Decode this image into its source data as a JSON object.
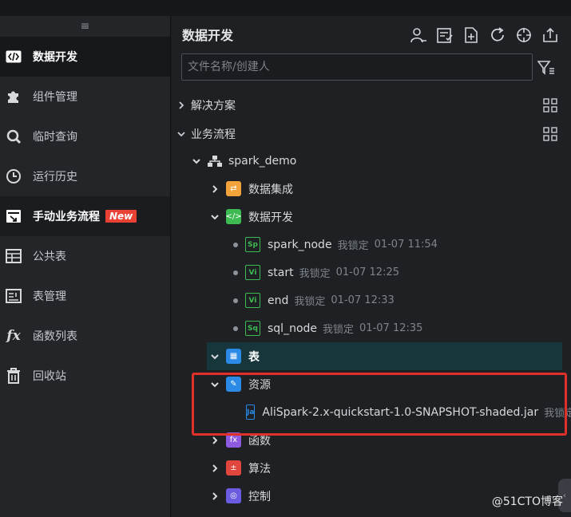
{
  "sidebar": {
    "items": [
      {
        "label": "数据开发",
        "icon": "code-icon"
      },
      {
        "label": "组件管理",
        "icon": "puzzle-icon"
      },
      {
        "label": "临时查询",
        "icon": "search-icon"
      },
      {
        "label": "运行历史",
        "icon": "clock-icon"
      },
      {
        "label": "手动业务流程",
        "icon": "manual-flow-icon",
        "badge": "New"
      },
      {
        "label": "公共表",
        "icon": "table-icon"
      },
      {
        "label": "表管理",
        "icon": "table-manage-icon"
      },
      {
        "label": "函数列表",
        "icon": "function-icon"
      },
      {
        "label": "回收站",
        "icon": "trash-icon"
      }
    ]
  },
  "panel": {
    "title": "数据开发",
    "search_placeholder": "文件名称/创建人"
  },
  "tree": {
    "solutions": "解决方案",
    "business_flow": "业务流程",
    "project": "spark_demo",
    "data_integration": "数据集成",
    "data_dev": "数据开发",
    "nodes": [
      {
        "tag": "Sp",
        "name": "spark_node",
        "lock": "我锁定",
        "time": "01-07 11:54"
      },
      {
        "tag": "Vi",
        "name": "start",
        "lock": "我锁定",
        "time": "01-07 12:25"
      },
      {
        "tag": "Vi",
        "name": "end",
        "lock": "我锁定",
        "time": "01-07 12:33"
      },
      {
        "tag": "Sq",
        "name": "sql_node",
        "lock": "我锁定",
        "time": "01-07 12:35"
      }
    ],
    "table": "表",
    "resource": "资源",
    "resource_file": {
      "tag": "Ja",
      "name": "AliSpark-2.x-quickstart-1.0-SNAPSHOT-shaded.jar",
      "lock": "我锁定"
    },
    "function": "函数",
    "algorithm": "算法",
    "control": "控制"
  },
  "colors": {
    "accent_green": "#3dbb52",
    "accent_blue": "#2b8ae6",
    "highlight_red": "#e0302a",
    "new_badge": "#e94235"
  },
  "watermark": "@51CTO博客"
}
